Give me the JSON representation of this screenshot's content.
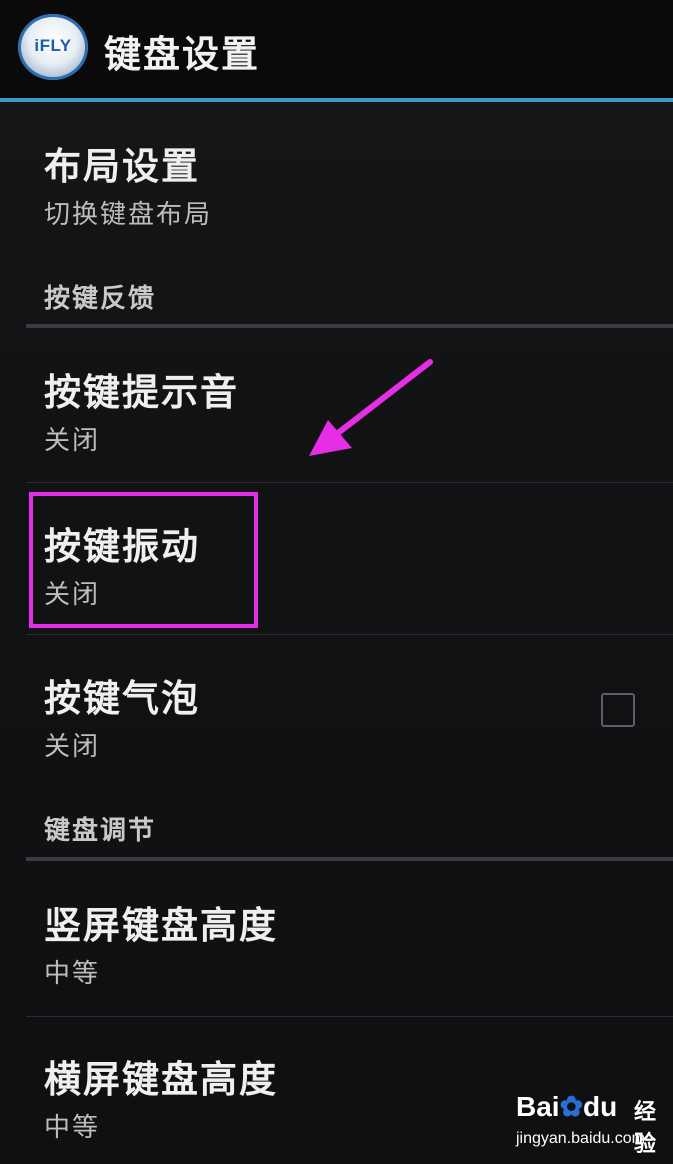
{
  "app": {
    "icon_text": "iFLY",
    "title": "键盘设置"
  },
  "settings": {
    "layout": {
      "title": "布局设置",
      "summary": "切换键盘布局"
    },
    "category_feedback": "按键反馈",
    "sound": {
      "title": "按键提示音",
      "summary": "关闭"
    },
    "vibration": {
      "title": "按键振动",
      "summary": "关闭"
    },
    "bubble": {
      "title": "按键气泡",
      "summary": "关闭",
      "checked": false
    },
    "category_adjust": "键盘调节",
    "portrait_height": {
      "title": "竖屏键盘高度",
      "summary": "中等"
    },
    "landscape_height": {
      "title": "横屏键盘高度",
      "summary": "中等"
    }
  },
  "annotation": {
    "color": "#e62ee6",
    "arrow_icon": "arrow-pointer-icon"
  },
  "watermark": {
    "logo_prefix": "Bai",
    "logo_suffix": "du",
    "brand": "经验",
    "url": "jingyan.baidu.com"
  },
  "colors": {
    "accent": "#3b9bc2",
    "background": "#111214"
  }
}
